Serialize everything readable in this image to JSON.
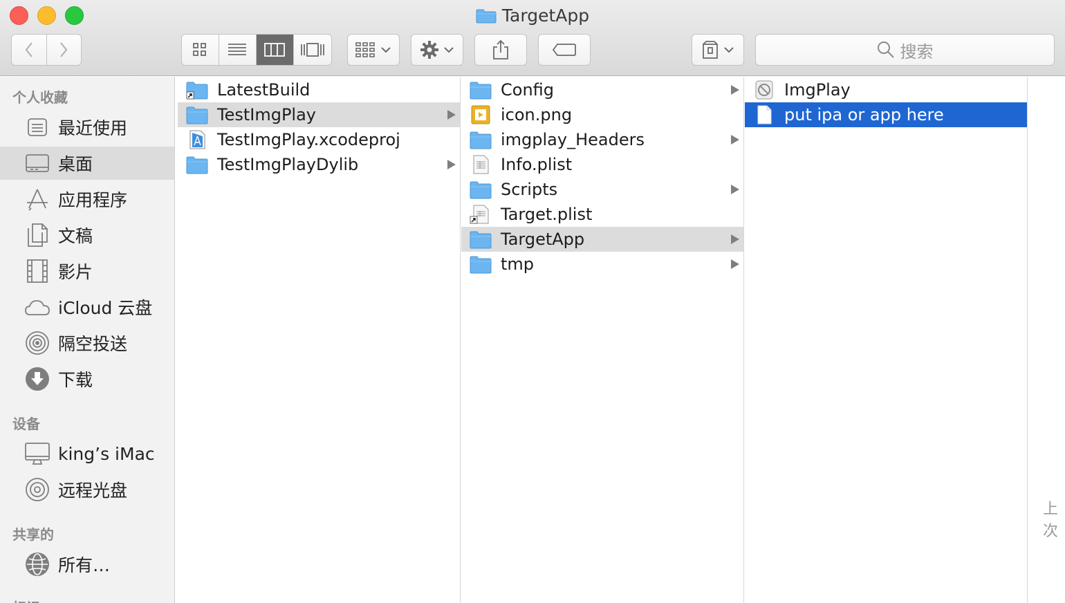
{
  "window": {
    "title": "TargetApp"
  },
  "toolbar": {
    "search_placeholder": "搜索",
    "view_modes": [
      "icon-view",
      "list-view",
      "column-view",
      "cover-flow-view"
    ],
    "active_view": "column-view"
  },
  "sidebar": {
    "favorites_header": "个人收藏",
    "favorites": [
      {
        "label": "最近使用",
        "icon": "recents-icon"
      },
      {
        "label": "桌面",
        "icon": "desktop-icon",
        "selected": true
      },
      {
        "label": "应用程序",
        "icon": "applications-icon"
      },
      {
        "label": "文稿",
        "icon": "documents-icon"
      },
      {
        "label": "影片",
        "icon": "movies-icon"
      },
      {
        "label": "iCloud 云盘",
        "icon": "icloud-icon"
      },
      {
        "label": "隔空投送",
        "icon": "airdrop-icon"
      },
      {
        "label": "下载",
        "icon": "downloads-icon"
      }
    ],
    "devices_header": "设备",
    "devices": [
      {
        "label": "king’s iMac",
        "icon": "imac-icon"
      },
      {
        "label": "远程光盘",
        "icon": "optical-disc-icon"
      }
    ],
    "shared_header": "共享的",
    "shared": [
      {
        "label": "所有…",
        "icon": "network-icon"
      }
    ],
    "tags_header_partial": "标记"
  },
  "columns": {
    "col1": [
      {
        "name": "LatestBuild",
        "type": "folder-alias",
        "arrow": false
      },
      {
        "name": "TestImgPlay",
        "type": "folder",
        "arrow": true,
        "state": "highlighted"
      },
      {
        "name": "TestImgPlay.xcodeproj",
        "type": "xcodeproj",
        "arrow": false
      },
      {
        "name": "TestImgPlayDylib",
        "type": "folder",
        "arrow": true
      }
    ],
    "col2": [
      {
        "name": "Config",
        "type": "folder",
        "arrow": true
      },
      {
        "name": "icon.png",
        "type": "image",
        "arrow": false
      },
      {
        "name": "imgplay_Headers",
        "type": "folder",
        "arrow": true
      },
      {
        "name": "Info.plist",
        "type": "plist",
        "arrow": false
      },
      {
        "name": "Scripts",
        "type": "folder",
        "arrow": true
      },
      {
        "name": "Target.plist",
        "type": "plist-alias",
        "arrow": false
      },
      {
        "name": "TargetApp",
        "type": "folder",
        "arrow": true,
        "state": "highlighted"
      },
      {
        "name": "tmp",
        "type": "folder",
        "arrow": true
      }
    ],
    "col3": [
      {
        "name": "ImgPlay",
        "type": "app-disabled",
        "arrow": false
      },
      {
        "name": "put ipa or app here",
        "type": "document",
        "arrow": false,
        "state": "selected"
      }
    ]
  },
  "edge_text": "上次",
  "colors": {
    "selection": "#1f66d3",
    "highlight": "#dcdcdc",
    "folder": "#6bb5f0"
  }
}
